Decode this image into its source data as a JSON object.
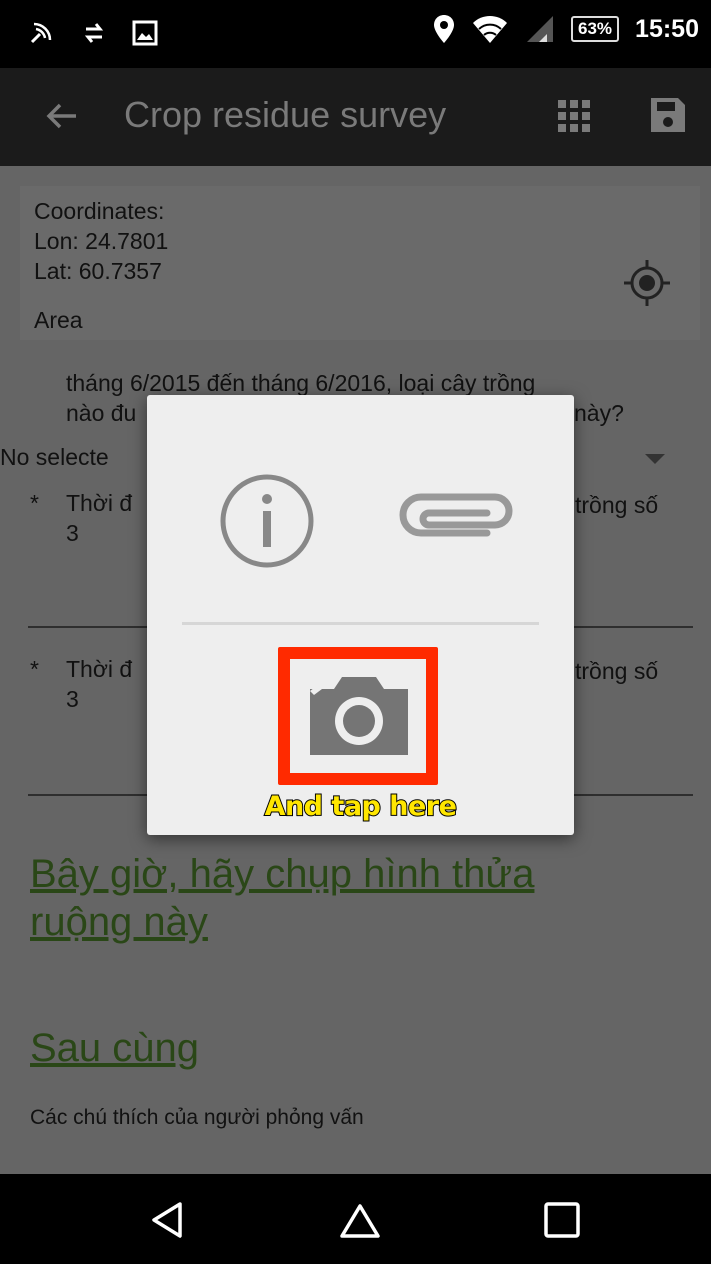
{
  "status_bar": {
    "battery": "63%",
    "time": "15:50"
  },
  "toolbar": {
    "title": "Crop residue survey"
  },
  "coordinates": {
    "heading": "Coordinates:",
    "lon": "Lon: 24.7801",
    "lat": "Lat: 60.7357",
    "area": "Area"
  },
  "question": {
    "line1": "tháng 6/2015 đến tháng 6/2016, loại cây trồng",
    "line2_start": "nào đu",
    "line2_end": "này?"
  },
  "select": {
    "value": "No selecte"
  },
  "required_fields": [
    {
      "star": "*",
      "text_start": "Thời đ",
      "text_end": "trồng số",
      "line2": "3"
    },
    {
      "star": "*",
      "text_start": "Thời đ",
      "text_end": "trồng số",
      "line2": "3"
    }
  ],
  "links": {
    "photo": "Bây giờ, hãy chụp hình thửa ruộng này",
    "finally": "Sau cùng"
  },
  "note": "Các chú thích của người phỏng vấn",
  "dialog": {
    "callout": "And tap here",
    "highlight_color": "#ff2a00"
  },
  "icons": [
    "nfc-icon",
    "sync-icon",
    "image-icon",
    "location-icon",
    "wifi-icon",
    "signal-icon",
    "back-arrow-icon",
    "grid-icon",
    "save-icon",
    "gps-target-icon",
    "info-icon",
    "attach-icon",
    "camera-icon",
    "nav-back-icon",
    "nav-home-icon",
    "nav-recents-icon"
  ]
}
